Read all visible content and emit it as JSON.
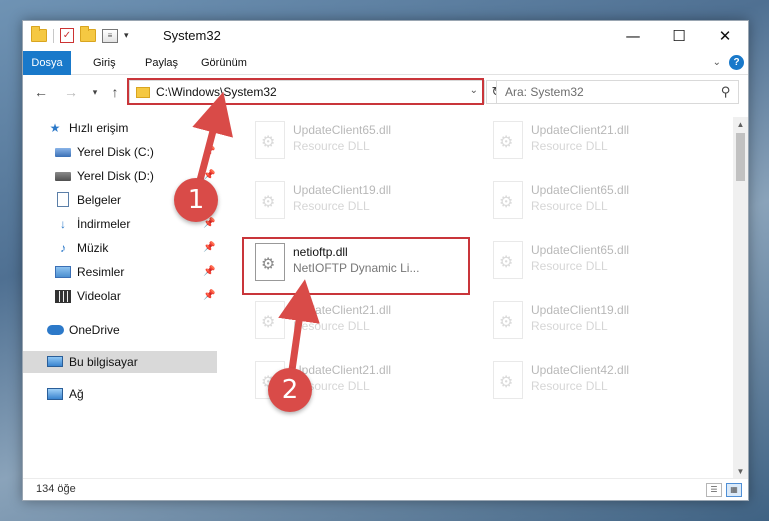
{
  "window": {
    "title": "System32",
    "controls": {
      "minimize": "—",
      "maximize": "☐",
      "close": "✕"
    }
  },
  "ribbon": {
    "tabs": [
      "Dosya",
      "Giriş",
      "Paylaş",
      "Görünüm"
    ]
  },
  "address": {
    "path": "C:\\Windows\\System32",
    "refresh": "↻"
  },
  "search": {
    "placeholder": "Ara: System32"
  },
  "sidebar": {
    "items": [
      {
        "label": "Hızlı erişim",
        "icon": "star-icon"
      },
      {
        "label": "Yerel Disk (C:)",
        "icon": "drive-icon",
        "pinned": true
      },
      {
        "label": "Yerel Disk (D:)",
        "icon": "drive-icon",
        "pinned": true
      },
      {
        "label": "Belgeler",
        "icon": "documents-icon",
        "pinned": true
      },
      {
        "label": "İndirmeler",
        "icon": "downloads-icon",
        "pinned": true
      },
      {
        "label": "Müzik",
        "icon": "music-icon",
        "pinned": true
      },
      {
        "label": "Resimler",
        "icon": "pictures-icon",
        "pinned": true
      },
      {
        "label": "Videolar",
        "icon": "videos-icon",
        "pinned": true
      },
      {
        "label": "OneDrive",
        "icon": "cloud-icon"
      },
      {
        "label": "Bu bilgisayar",
        "icon": "computer-icon",
        "selected": true
      },
      {
        "label": "Ağ",
        "icon": "network-icon"
      }
    ]
  },
  "files": [
    {
      "name": "UpdateClient65.dll",
      "desc": "Resource DLL"
    },
    {
      "name": "UpdateClient21.dll",
      "desc": "Resource DLL"
    },
    {
      "name": "UpdateClient19.dll",
      "desc": "Resource DLL"
    },
    {
      "name": "UpdateClient65.dll",
      "desc": "Resource DLL"
    },
    {
      "name": "netioftp.dll",
      "desc": "NetIOFTP Dynamic Li..."
    },
    {
      "name": "UpdateClient65.dll",
      "desc": "Resource DLL"
    },
    {
      "name": "UpdateClient21.dll",
      "desc": "Resource DLL"
    },
    {
      "name": "UpdateClient19.dll",
      "desc": "Resource DLL"
    },
    {
      "name": "UpdateClient21.dll",
      "desc": "Resource DLL"
    },
    {
      "name": "UpdateClient42.dll",
      "desc": "Resource DLL"
    }
  ],
  "status": {
    "count": "134 öğe"
  },
  "annotations": {
    "step1": "1",
    "step2": "2",
    "color": "#d94b48"
  }
}
